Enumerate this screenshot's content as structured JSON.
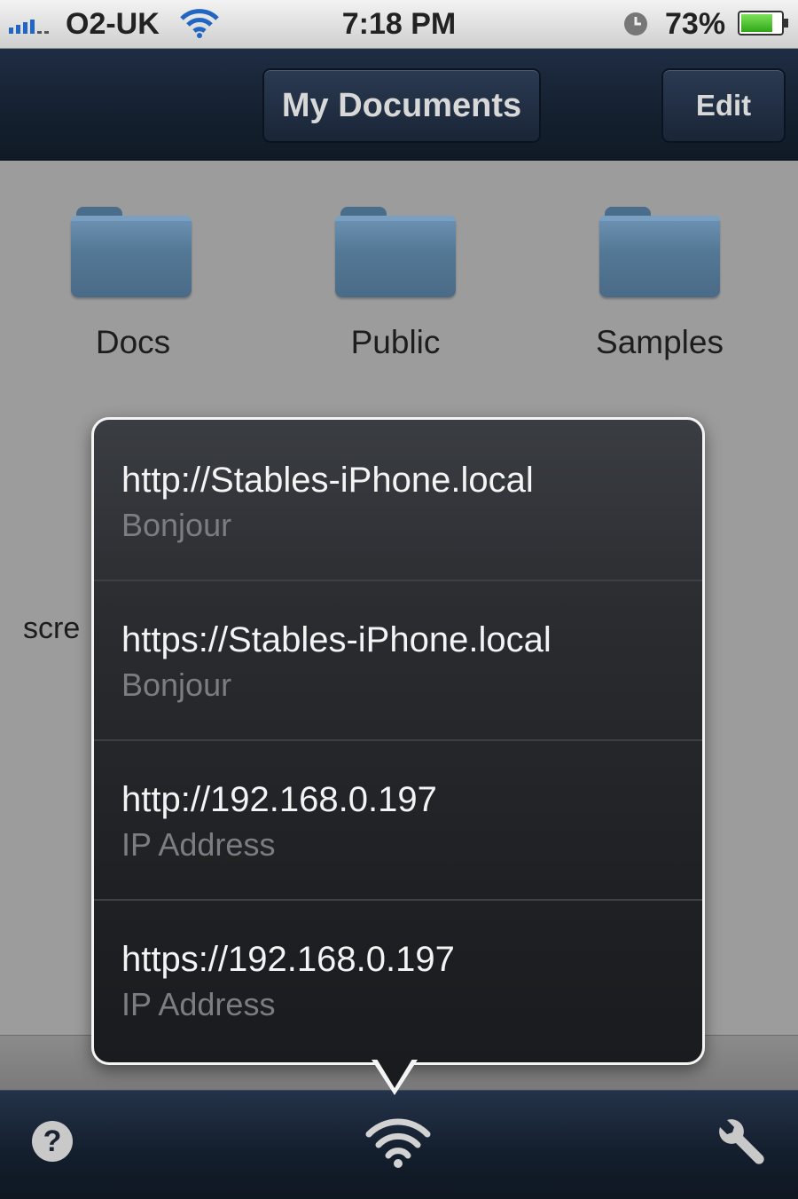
{
  "status_bar": {
    "carrier": "O2-UK",
    "time": "7:18 PM",
    "battery_percent": "73%",
    "icons": [
      "signal-icon",
      "wifi-icon",
      "clock-icon",
      "battery-icon"
    ]
  },
  "nav": {
    "title": "My Documents",
    "edit_label": "Edit"
  },
  "folders": [
    {
      "label": "Docs",
      "icon": "folder-icon"
    },
    {
      "label": "Public",
      "icon": "folder-icon"
    },
    {
      "label": "Samples",
      "icon": "folder-icon"
    }
  ],
  "background_text": "scre",
  "popover": {
    "items": [
      {
        "url": "http://Stables-iPhone.local",
        "type": "Bonjour"
      },
      {
        "url": "https://Stables-iPhone.local",
        "type": "Bonjour"
      },
      {
        "url": "http://192.168.0.197",
        "type": "IP Address"
      },
      {
        "url": "https://192.168.0.197",
        "type": "IP Address"
      }
    ]
  },
  "toolbar": {
    "help_glyph": "?",
    "icons": [
      "help-icon",
      "wifi-icon",
      "wrench-icon"
    ]
  },
  "colors": {
    "nav_bar": "#1a2536",
    "popover_bg": "#2a2c30",
    "folder": "#537895",
    "signal_bars": "#2266c4",
    "battery_fill": "#34c01c"
  }
}
